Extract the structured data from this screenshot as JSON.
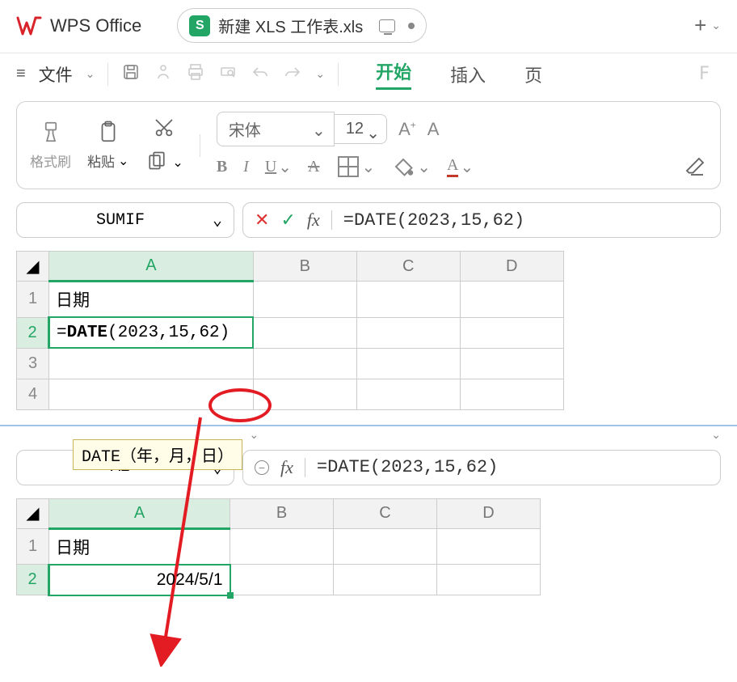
{
  "titlebar": {
    "app_name": "WPS Office",
    "tab": {
      "icon_letter": "S",
      "label": "新建 XLS 工作表.xls"
    }
  },
  "menu": {
    "file_label": "文件",
    "tabs": {
      "start": "开始",
      "insert": "插入",
      "page": "页"
    },
    "trailing_col": "F"
  },
  "ribbon": {
    "format_brush": "格式刷",
    "paste": "粘贴",
    "font_name": "宋体",
    "font_size": "12",
    "bold": "B",
    "italic": "I",
    "underline": "U",
    "strike": "A"
  },
  "pane1": {
    "namebox": "SUMIF",
    "formula": "=DATE(2023,15,62)",
    "columns": [
      "A",
      "B",
      "C",
      "D"
    ],
    "rows": [
      "1",
      "2",
      "3",
      "4"
    ],
    "a1": "日期",
    "a2_prefix": "=",
    "a2_fn": "DATE",
    "a2_args": "(2023,15,62)",
    "tooltip": "DATE（年，月，日）"
  },
  "pane2": {
    "namebox": "A2",
    "formula": "=DATE(2023,15,62)",
    "columns": [
      "A",
      "B",
      "C",
      "D"
    ],
    "rows": [
      "1",
      "2"
    ],
    "a1": "日期",
    "a2": "2024/5/1"
  }
}
